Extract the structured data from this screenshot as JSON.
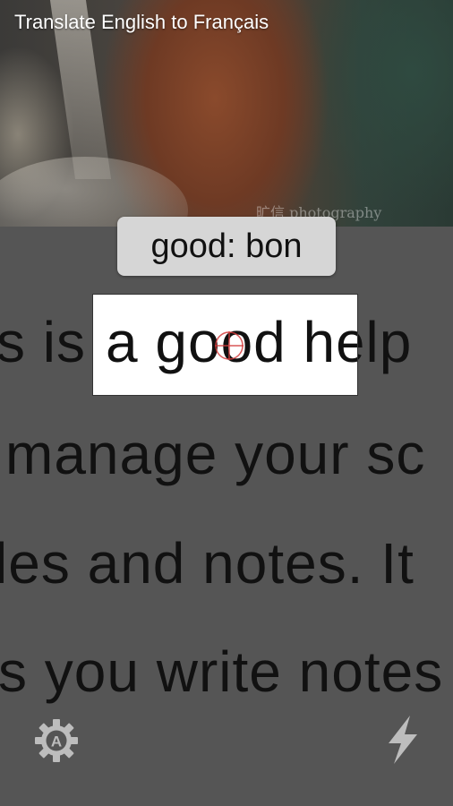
{
  "header": {
    "title": "Translate English to Français"
  },
  "photo": {
    "watermark": "旷信 photography"
  },
  "translation": {
    "text": "good: bon"
  },
  "focus": {
    "text": "a good he"
  },
  "camera_text": {
    "lines": [
      "s is a good help",
      "manage your sc",
      "les and notes. It",
      "s you write notes"
    ]
  },
  "toolbar": {
    "settings_icon": "gear-with-A-icon",
    "flash_icon": "lightning-bolt-icon"
  },
  "colors": {
    "background": "#555555",
    "crosshair": "#d23a3a",
    "bubble": "#d6d6d6",
    "icon": "#bdbdbd"
  }
}
